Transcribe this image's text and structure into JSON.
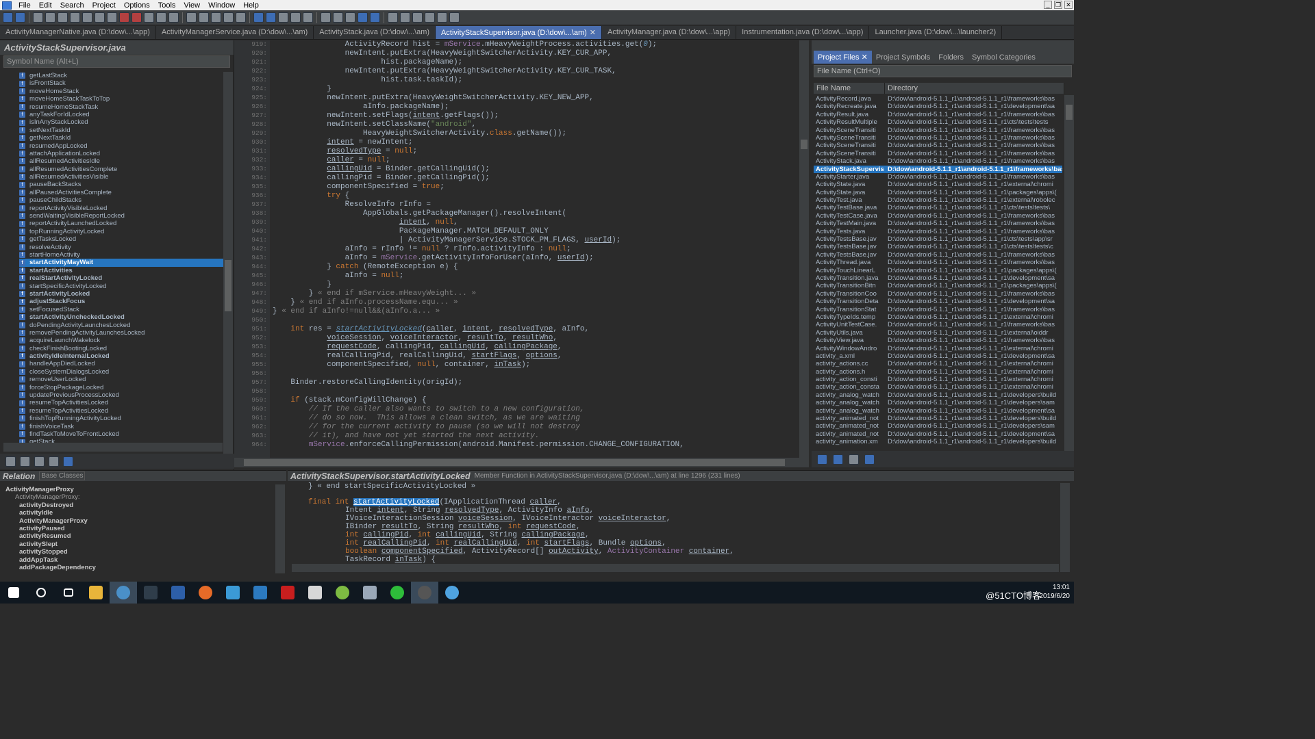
{
  "menu": {
    "items": [
      "File",
      "Edit",
      "Search",
      "Project",
      "Options",
      "Tools",
      "View",
      "Window",
      "Help"
    ]
  },
  "file_tabs": [
    {
      "label": "ActivityManagerNative.java (D:\\dow\\...\\app)",
      "active": false
    },
    {
      "label": "ActivityManagerService.java (D:\\dow\\...\\am)",
      "active": false
    },
    {
      "label": "ActivityStack.java (D:\\dow\\...\\am)",
      "active": false
    },
    {
      "label": "ActivityStackSupervisor.java (D:\\dow\\...\\am)",
      "active": true
    },
    {
      "label": "ActivityManager.java (D:\\dow\\...\\app)",
      "active": false
    },
    {
      "label": "Instrumentation.java (D:\\dow\\...\\app)",
      "active": false
    },
    {
      "label": "Launcher.java (D:\\dow\\...\\launcher2)",
      "active": false
    }
  ],
  "symbol_panel": {
    "title": "ActivityStackSupervisor.java",
    "search_placeholder": "Symbol Name (Alt+L)",
    "items": [
      {
        "label": "getLastStack",
        "bold": false
      },
      {
        "label": "isFrontStack",
        "bold": false
      },
      {
        "label": "moveHomeStack",
        "bold": false
      },
      {
        "label": "moveHomeStackTaskToTop",
        "bold": false
      },
      {
        "label": "resumeHomeStackTask",
        "bold": false
      },
      {
        "label": "anyTaskForIdLocked",
        "bold": false
      },
      {
        "label": "isInAnyStackLocked",
        "bold": false
      },
      {
        "label": "setNextTaskId",
        "bold": false
      },
      {
        "label": "getNextTaskId",
        "bold": false
      },
      {
        "label": "resumedAppLocked",
        "bold": false
      },
      {
        "label": "attachApplicationLocked",
        "bold": false
      },
      {
        "label": "allResumedActivitiesIdle",
        "bold": false
      },
      {
        "label": "allResumedActivitiesComplete",
        "bold": false
      },
      {
        "label": "allResumedActivitiesVisible",
        "bold": false
      },
      {
        "label": "pauseBackStacks",
        "bold": false
      },
      {
        "label": "allPausedActivitiesComplete",
        "bold": false
      },
      {
        "label": "pauseChildStacks",
        "bold": false
      },
      {
        "label": "reportActivityVisibleLocked",
        "bold": false
      },
      {
        "label": "sendWaitingVisibleReportLocked",
        "bold": false
      },
      {
        "label": "reportActivityLaunchedLocked",
        "bold": false
      },
      {
        "label": "topRunningActivityLocked",
        "bold": false
      },
      {
        "label": "getTasksLocked",
        "bold": false
      },
      {
        "label": "resolveActivity",
        "bold": false
      },
      {
        "label": "startHomeActivity",
        "bold": false
      },
      {
        "label": "startActivityMayWait",
        "bold": true,
        "selected": true
      },
      {
        "label": "startActivities",
        "bold": true
      },
      {
        "label": "realStartActivityLocked",
        "bold": true
      },
      {
        "label": "startSpecificActivityLocked",
        "bold": false
      },
      {
        "label": "startActivityLocked",
        "bold": true
      },
      {
        "label": "adjustStackFocus",
        "bold": true
      },
      {
        "label": "setFocusedStack",
        "bold": false
      },
      {
        "label": "startActivityUncheckedLocked",
        "bold": true
      },
      {
        "label": "doPendingActivityLaunchesLocked",
        "bold": false
      },
      {
        "label": "removePendingActivityLaunchesLocked",
        "bold": false
      },
      {
        "label": "acquireLaunchWakelock",
        "bold": false
      },
      {
        "label": "checkFinishBootingLocked",
        "bold": false
      },
      {
        "label": "activityIdleInternalLocked",
        "bold": true
      },
      {
        "label": "handleAppDiedLocked",
        "bold": false
      },
      {
        "label": "closeSystemDialogsLocked",
        "bold": false
      },
      {
        "label": "removeUserLocked",
        "bold": false
      },
      {
        "label": "forceStopPackageLocked",
        "bold": false
      },
      {
        "label": "updatePreviousProcessLocked",
        "bold": false
      },
      {
        "label": "resumeTopActivitiesLocked",
        "bold": false
      },
      {
        "label": "resumeTopActivitiesLocked",
        "bold": false
      },
      {
        "label": "finishTopRunningActivityLocked",
        "bold": false
      },
      {
        "label": "finishVoiceTask",
        "bold": false
      },
      {
        "label": "findTaskToMoveToFrontLocked",
        "bold": false
      },
      {
        "label": "getStack",
        "bold": false
      }
    ]
  },
  "editor": {
    "line_numbers": [
      "919:",
      "920:",
      "921:",
      "922:",
      "923:",
      "924:",
      "925:",
      "926:",
      "927:",
      "928:",
      "929:",
      "930:",
      "931:",
      "932:",
      "933:",
      "934:",
      "935:",
      "936:",
      "937:",
      "938:",
      "939:",
      "940:",
      "941:",
      "942:",
      "943:",
      "944:",
      "945:",
      "946:",
      "947:",
      "948:",
      "949:",
      "950:",
      "951:",
      "952:",
      "953:",
      "954:",
      "955:",
      "956:",
      "957:",
      "958:",
      "959:",
      "960:",
      "961:",
      "962:",
      "963:",
      "964:"
    ]
  },
  "project_panel": {
    "tabs": [
      "Project Files",
      "Project Symbols",
      "Folders",
      "Symbol Categories"
    ],
    "search_placeholder": "File Name (Ctrl+O)",
    "col_file": "File Name",
    "col_dir": "Directory",
    "files": [
      {
        "name": "ActivityRecord.java",
        "dir": "D:\\dow\\android-5.1.1_r1\\android-5.1.1_r1\\frameworks\\bas"
      },
      {
        "name": "ActivityRecreate.java",
        "dir": "D:\\dow\\android-5.1.1_r1\\android-5.1.1_r1\\development\\sa"
      },
      {
        "name": "ActivityResult.java",
        "dir": "D:\\dow\\android-5.1.1_r1\\android-5.1.1_r1\\frameworks\\bas"
      },
      {
        "name": "ActivityResultMultiple",
        "dir": "D:\\dow\\android-5.1.1_r1\\android-5.1.1_r1\\cts\\tests\\tests"
      },
      {
        "name": "ActivitySceneTransiti",
        "dir": "D:\\dow\\android-5.1.1_r1\\android-5.1.1_r1\\frameworks\\bas"
      },
      {
        "name": "ActivitySceneTransiti",
        "dir": "D:\\dow\\android-5.1.1_r1\\android-5.1.1_r1\\frameworks\\bas"
      },
      {
        "name": "ActivitySceneTransiti",
        "dir": "D:\\dow\\android-5.1.1_r1\\android-5.1.1_r1\\frameworks\\bas"
      },
      {
        "name": "ActivitySceneTransiti",
        "dir": "D:\\dow\\android-5.1.1_r1\\android-5.1.1_r1\\frameworks\\bas"
      },
      {
        "name": "ActivityStack.java",
        "dir": "D:\\dow\\android-5.1.1_r1\\android-5.1.1_r1\\frameworks\\bas"
      },
      {
        "name": "ActivityStackSupervis",
        "dir": "D:\\dow\\android-5.1.1_r1\\android-5.1.1_r1\\frameworks\\bas",
        "selected": true
      },
      {
        "name": "ActivityStarter.java",
        "dir": "D:\\dow\\android-5.1.1_r1\\android-5.1.1_r1\\frameworks\\bas"
      },
      {
        "name": "ActivityState.java",
        "dir": "D:\\dow\\android-5.1.1_r1\\android-5.1.1_r1\\external\\chromi"
      },
      {
        "name": "ActivityState.java",
        "dir": "D:\\dow\\android-5.1.1_r1\\android-5.1.1_r1\\packages\\apps\\("
      },
      {
        "name": "ActivityTest.java",
        "dir": "D:\\dow\\android-5.1.1_r1\\android-5.1.1_r1\\external\\robolec"
      },
      {
        "name": "ActivityTestBase.java",
        "dir": "D:\\dow\\android-5.1.1_r1\\android-5.1.1_r1\\cts\\tests\\tests\\"
      },
      {
        "name": "ActivityTestCase.java",
        "dir": "D:\\dow\\android-5.1.1_r1\\android-5.1.1_r1\\frameworks\\bas"
      },
      {
        "name": "ActivityTestMain.java",
        "dir": "D:\\dow\\android-5.1.1_r1\\android-5.1.1_r1\\frameworks\\bas"
      },
      {
        "name": "ActivityTests.java",
        "dir": "D:\\dow\\android-5.1.1_r1\\android-5.1.1_r1\\frameworks\\bas"
      },
      {
        "name": "ActivityTestsBase.jav",
        "dir": "D:\\dow\\android-5.1.1_r1\\android-5.1.1_r1\\cts\\tests\\app\\sr"
      },
      {
        "name": "ActivityTestsBase.jav",
        "dir": "D:\\dow\\android-5.1.1_r1\\android-5.1.1_r1\\cts\\tests\\tests\\c"
      },
      {
        "name": "ActivityTestsBase.jav",
        "dir": "D:\\dow\\android-5.1.1_r1\\android-5.1.1_r1\\frameworks\\bas"
      },
      {
        "name": "ActivityThread.java",
        "dir": "D:\\dow\\android-5.1.1_r1\\android-5.1.1_r1\\frameworks\\bas"
      },
      {
        "name": "ActivityTouchLinearL",
        "dir": "D:\\dow\\android-5.1.1_r1\\android-5.1.1_r1\\packages\\apps\\("
      },
      {
        "name": "ActivityTransition.java",
        "dir": "D:\\dow\\android-5.1.1_r1\\android-5.1.1_r1\\development\\sa"
      },
      {
        "name": "ActivityTransitionBitn",
        "dir": "D:\\dow\\android-5.1.1_r1\\android-5.1.1_r1\\packages\\apps\\("
      },
      {
        "name": "ActivityTransitionCoo",
        "dir": "D:\\dow\\android-5.1.1_r1\\android-5.1.1_r1\\frameworks\\bas"
      },
      {
        "name": "ActivityTransitionDeta",
        "dir": "D:\\dow\\android-5.1.1_r1\\android-5.1.1_r1\\development\\sa"
      },
      {
        "name": "ActivityTransitionStat",
        "dir": "D:\\dow\\android-5.1.1_r1\\android-5.1.1_r1\\frameworks\\bas"
      },
      {
        "name": "ActivityTypeIds.temp",
        "dir": "D:\\dow\\android-5.1.1_r1\\android-5.1.1_r1\\external\\chromi"
      },
      {
        "name": "ActivityUnitTestCase.",
        "dir": "D:\\dow\\android-5.1.1_r1\\android-5.1.1_r1\\frameworks\\bas"
      },
      {
        "name": "ActivityUtils.java",
        "dir": "D:\\dow\\android-5.1.1_r1\\android-5.1.1_r1\\external\\oiddr"
      },
      {
        "name": "ActivityView.java",
        "dir": "D:\\dow\\android-5.1.1_r1\\android-5.1.1_r1\\frameworks\\bas"
      },
      {
        "name": "ActivityWindowAndro",
        "dir": "D:\\dow\\android-5.1.1_r1\\android-5.1.1_r1\\external\\chromi"
      },
      {
        "name": "activity_a.xml",
        "dir": "D:\\dow\\android-5.1.1_r1\\android-5.1.1_r1\\development\\sa"
      },
      {
        "name": "activity_actions.cc",
        "dir": "D:\\dow\\android-5.1.1_r1\\android-5.1.1_r1\\external\\chromi"
      },
      {
        "name": "activity_actions.h",
        "dir": "D:\\dow\\android-5.1.1_r1\\android-5.1.1_r1\\external\\chromi"
      },
      {
        "name": "activity_action_consti",
        "dir": "D:\\dow\\android-5.1.1_r1\\android-5.1.1_r1\\external\\chromi"
      },
      {
        "name": "activity_action_consta",
        "dir": "D:\\dow\\android-5.1.1_r1\\android-5.1.1_r1\\external\\chromi"
      },
      {
        "name": "activity_analog_watch",
        "dir": "D:\\dow\\android-5.1.1_r1\\android-5.1.1_r1\\developers\\build"
      },
      {
        "name": "activity_analog_watch",
        "dir": "D:\\dow\\android-5.1.1_r1\\android-5.1.1_r1\\developers\\sam"
      },
      {
        "name": "activity_analog_watch",
        "dir": "D:\\dow\\android-5.1.1_r1\\android-5.1.1_r1\\development\\sa"
      },
      {
        "name": "activity_animated_not",
        "dir": "D:\\dow\\android-5.1.1_r1\\android-5.1.1_r1\\developers\\build"
      },
      {
        "name": "activity_animated_not",
        "dir": "D:\\dow\\android-5.1.1_r1\\android-5.1.1_r1\\developers\\sam"
      },
      {
        "name": "activity_animated_not",
        "dir": "D:\\dow\\android-5.1.1_r1\\android-5.1.1_r1\\development\\sa"
      },
      {
        "name": "activity_animation.xm",
        "dir": "D:\\dow\\android-5.1.1_r1\\android-5.1.1_r1\\developers\\build"
      }
    ]
  },
  "relation_panel": {
    "title": "Relation",
    "base_label": "Base Classes",
    "root": "ActivityManagerProxy",
    "category": "ActivityManagerProxy:",
    "members": [
      "activityDestroyed",
      "activityIdle",
      "ActivityManagerProxy",
      "activityPaused",
      "activityResumed",
      "activitySlept",
      "activityStopped",
      "addAppTask",
      "addPackageDependency"
    ]
  },
  "context_panel": {
    "title": "ActivityStackSupervisor.startActivityLocked",
    "info": "Member Function in ActivityStackSupervisor.java (D:\\dow\\...\\am) at line 1296 (231 lines)"
  },
  "taskbar": {
    "watermark": "@51CTO博客",
    "time": "13:01",
    "date": "2019/6/20"
  }
}
